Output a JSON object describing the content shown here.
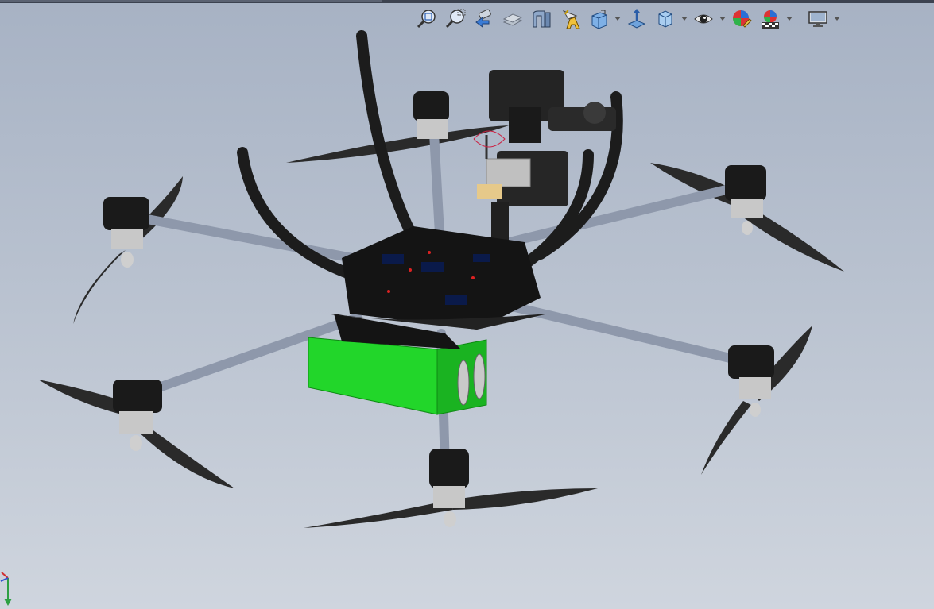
{
  "app": {
    "viewport_background_top": "#a7b2c4",
    "viewport_background_bottom": "#cfd5de"
  },
  "toolbar": {
    "icons": [
      "zoom-to-fit-icon",
      "zoom-to-area-icon",
      "previous-view-icon",
      "section-view-icon",
      "dynamic-annotation-icon",
      "view-orientation-icon",
      "display-style-icon",
      "hide-show-items-icon",
      "edit-appearance-icon",
      "apply-scene-icon",
      "view-settings-icon"
    ]
  },
  "model": {
    "frame_color": "#1c1c1c",
    "arm_color": "#8e98ab",
    "battery_color": "#22d62a",
    "motor_color": "#c8c8c8",
    "motor_count": 6
  }
}
